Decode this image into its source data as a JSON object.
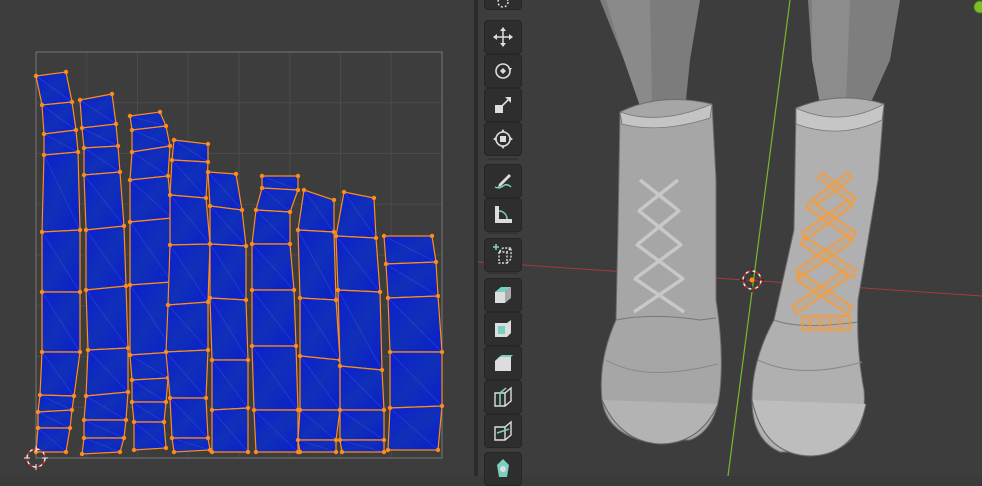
{
  "app": {
    "name": "",
    "panes": [
      "uv-editor",
      "3d-viewport"
    ]
  },
  "colors": {
    "uv_face": "#0a1fcc",
    "uv_edge": "#ff8c1a",
    "uv_vertex": "#ff8c1a",
    "grid_line": "#4a4a4a",
    "uv_bounds": "#7a7a7a",
    "background": "#3d3d3d",
    "x_axis": "#c03c3c",
    "y_axis": "#7cbd2a",
    "mesh_grey": "#9a9a9a",
    "selected_mesh": "#ff9a2e"
  },
  "uv_editor": {
    "cursor": "2d-cursor-icon",
    "islands_count": 9
  },
  "viewport": {
    "object": "boots",
    "selection": "laces-right-boot",
    "cursor": "3d-cursor-icon"
  },
  "toolbar": {
    "tools": [
      {
        "name": "cursor-tool",
        "icon": "cursor-icon"
      },
      {
        "name": "move-tool",
        "icon": "move-icon"
      },
      {
        "name": "rotate-tool",
        "icon": "rotate-icon"
      },
      {
        "name": "scale-tool",
        "icon": "scale-icon"
      },
      {
        "name": "transform-tool",
        "icon": "transform-icon"
      },
      {
        "name": "annotate-tool",
        "icon": "annotate-icon"
      },
      {
        "name": "measure-tool",
        "icon": "measure-icon"
      },
      {
        "name": "add-cube-tool",
        "icon": "add-cube-icon"
      },
      {
        "name": "extrude-tool",
        "icon": "extrude-icon"
      },
      {
        "name": "inset-tool",
        "icon": "inset-icon"
      },
      {
        "name": "bevel-tool",
        "icon": "bevel-icon"
      },
      {
        "name": "loop-cut-tool",
        "icon": "loop-cut-icon"
      },
      {
        "name": "knife-tool",
        "icon": "knife-icon"
      },
      {
        "name": "poly-build-tool",
        "icon": "poly-build-icon"
      }
    ]
  }
}
